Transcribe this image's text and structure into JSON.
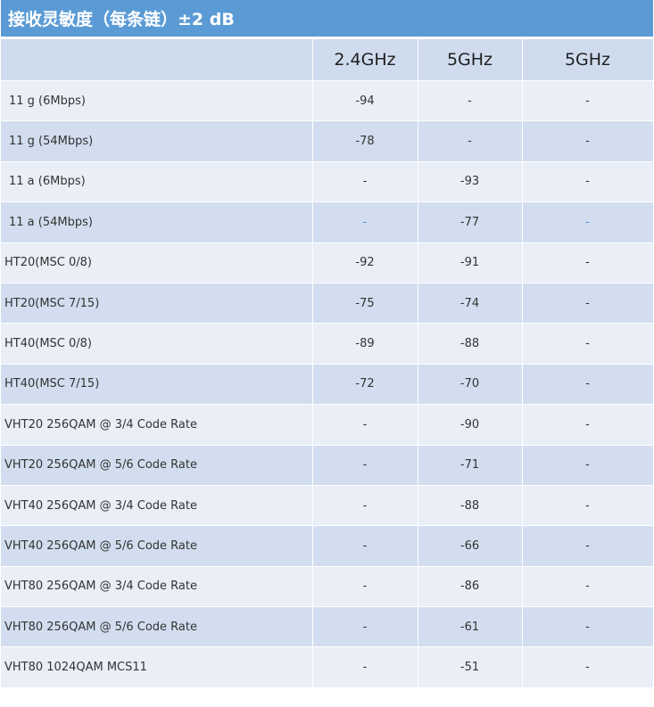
{
  "title": "接收灵敏度（每条链）±2 dB",
  "headers": [
    "",
    "2.4GHz",
    "5GHz",
    "5GHz"
  ],
  "rows": [
    {
      "label": "11 g (6Mbps)",
      "c1": "-94",
      "c2": "-",
      "c3": "-"
    },
    {
      "label": "11 g (54Mbps)",
      "c1": "-78",
      "c2": "-",
      "c3": "-"
    },
    {
      "label": "11 a (6Mbps)",
      "c1": "-",
      "c2": "-93",
      "c3": "-"
    },
    {
      "label": "11 a (54Mbps)",
      "c1": "-",
      "c2": "-77",
      "c3": "-"
    },
    {
      "label": "HT20(MSC 0/8)",
      "c1": "-92",
      "c2": "-91",
      "c3": "-"
    },
    {
      "label": "HT20(MSC 7/15)",
      "c1": "-75",
      "c2": "-74",
      "c3": "-"
    },
    {
      "label": "HT40(MSC 0/8)",
      "c1": "-89",
      "c2": "-88",
      "c3": "-"
    },
    {
      "label": "HT40(MSC 7/15)",
      "c1": "-72",
      "c2": "-70",
      "c3": "-"
    },
    {
      "label": "VHT20 256QAM @ 3/4 Code Rate",
      "c1": "-",
      "c2": "-90",
      "c3": "-"
    },
    {
      "label": "VHT20 256QAM @ 5/6 Code Rate",
      "c1": "-",
      "c2": "-71",
      "c3": "-"
    },
    {
      "label": "VHT40 256QAM @ 3/4 Code Rate",
      "c1": "-",
      "c2": "-88",
      "c3": "-"
    },
    {
      "label": "VHT40 256QAM @ 5/6 Code Rate",
      "c1": "-",
      "c2": "-66",
      "c3": "-"
    },
    {
      "label": "VHT80 256QAM @ 3/4 Code Rate",
      "c1": "-",
      "c2": "-86",
      "c3": "-"
    },
    {
      "label": "VHT80 256QAM @ 5/6 Code Rate",
      "c1": "-",
      "c2": "-61",
      "c3": "-"
    },
    {
      "label": "VHT80 1024QAM MCS11",
      "c1": "-",
      "c2": "-51",
      "c3": "-"
    }
  ],
  "colors": {
    "title_bg": "#5b9bd5",
    "header_bg": "#cfdcee",
    "row_odd": "#e9eef7",
    "row_even": "#d2deef"
  }
}
